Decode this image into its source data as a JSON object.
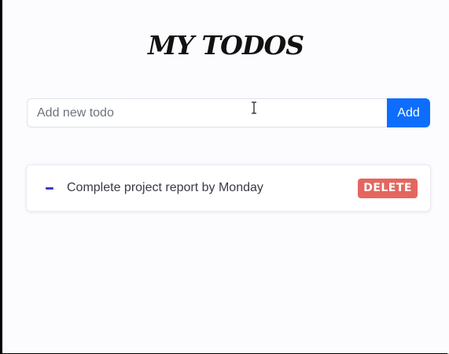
{
  "header": {
    "title": "MY TODOS"
  },
  "new_todo": {
    "placeholder": "Add new todo",
    "value": "",
    "add_label": "Add"
  },
  "todos": [
    {
      "text": "Complete project report by Monday",
      "delete_label": "DELETE"
    }
  ],
  "colors": {
    "add_button": "#0d6efd",
    "delete_button": "#e4675f",
    "bullet": "#3f3acb"
  }
}
